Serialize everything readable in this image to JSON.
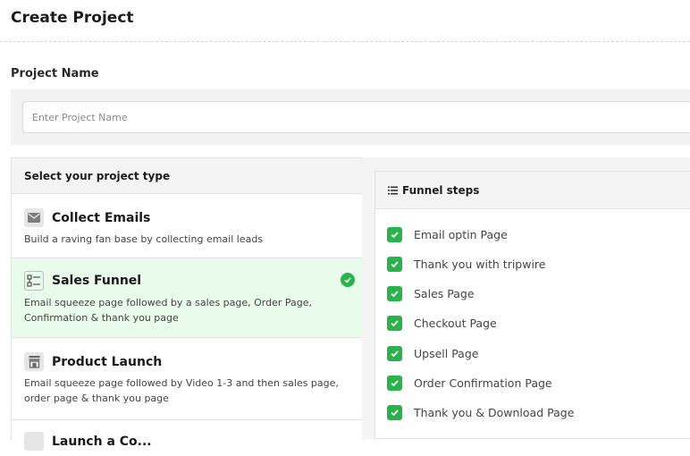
{
  "page": {
    "title": "Create Project"
  },
  "project_name": {
    "label": "Project Name",
    "placeholder": "Enter Project Name",
    "value": ""
  },
  "project_types": {
    "header": "Select your project type",
    "items": [
      {
        "title": "Collect Emails",
        "description": "Build a raving fan base by collecting email leads",
        "icon": "envelope-icon",
        "selected": false
      },
      {
        "title": "Sales Funnel",
        "description": "Email squeeze page followed by a sales page, Order Page, Confirmation & thank you page",
        "icon": "funnel-flow-icon",
        "selected": true
      },
      {
        "title": "Product Launch",
        "description": "Email squeeze page followed by Video 1-3 and then sales page, order page & thank you page",
        "icon": "store-icon",
        "selected": false
      },
      {
        "title": "Launch a Co...",
        "description": "",
        "icon": "page-icon",
        "selected": false
      }
    ]
  },
  "funnel_steps": {
    "title": "Funnel steps",
    "icon": "list-icon",
    "steps": [
      {
        "label": "Email optin Page",
        "checked": true
      },
      {
        "label": "Thank you with tripwire",
        "checked": true
      },
      {
        "label": "Sales Page",
        "checked": true
      },
      {
        "label": "Checkout Page",
        "checked": true
      },
      {
        "label": "Upsell Page",
        "checked": true
      },
      {
        "label": "Order Confirmation Page",
        "checked": true
      },
      {
        "label": "Thank you & Download Page",
        "checked": true
      }
    ]
  },
  "colors": {
    "accent_green": "#2ab34a",
    "selected_bg": "#e9fbea"
  }
}
